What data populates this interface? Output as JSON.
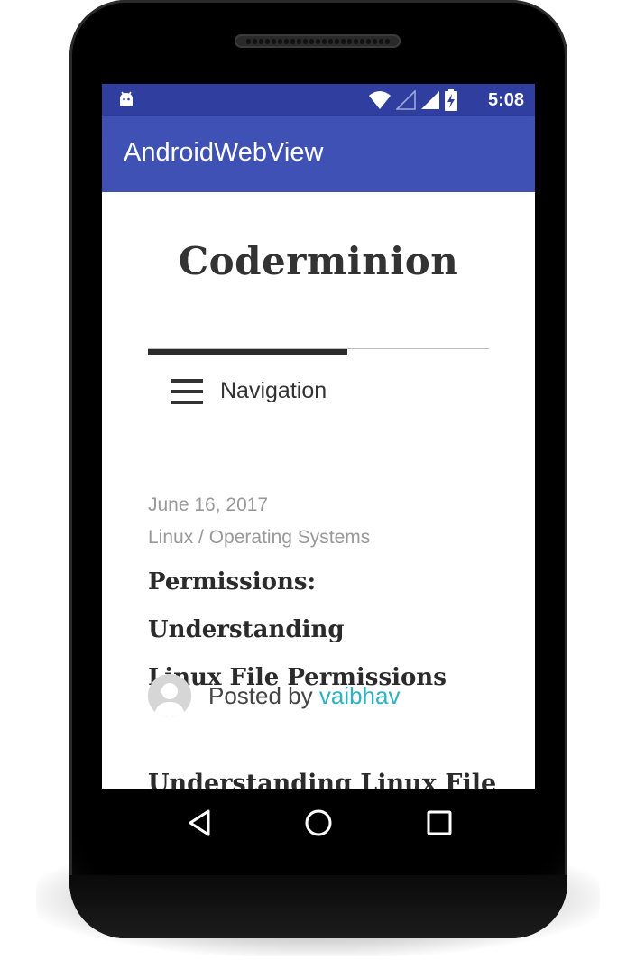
{
  "status_bar": {
    "time": "5:08",
    "notification_icon": "android-debug-icon",
    "icons": [
      "wifi-icon",
      "signal-empty-icon",
      "signal-icon",
      "battery-charging-icon"
    ]
  },
  "app_bar": {
    "title": "AndroidWebView"
  },
  "web": {
    "site_title": "Coderminion",
    "nav_label": "Navigation",
    "post": {
      "date": "June 16, 2017",
      "categories": "Linux / Operating Systems",
      "title_line1": "Permissions: Understanding",
      "title_line2": "Linux File Permissions",
      "posted_by": "Posted by ",
      "author": "vaibhav",
      "excerpt_heading": "Understanding Linux File"
    }
  },
  "nav_bar": {
    "buttons": [
      "back-icon",
      "home-icon",
      "recents-icon"
    ]
  },
  "colors": {
    "status_bar": "#303f9f",
    "app_bar": "#3f51b5",
    "author_link": "#2eb1c0"
  }
}
